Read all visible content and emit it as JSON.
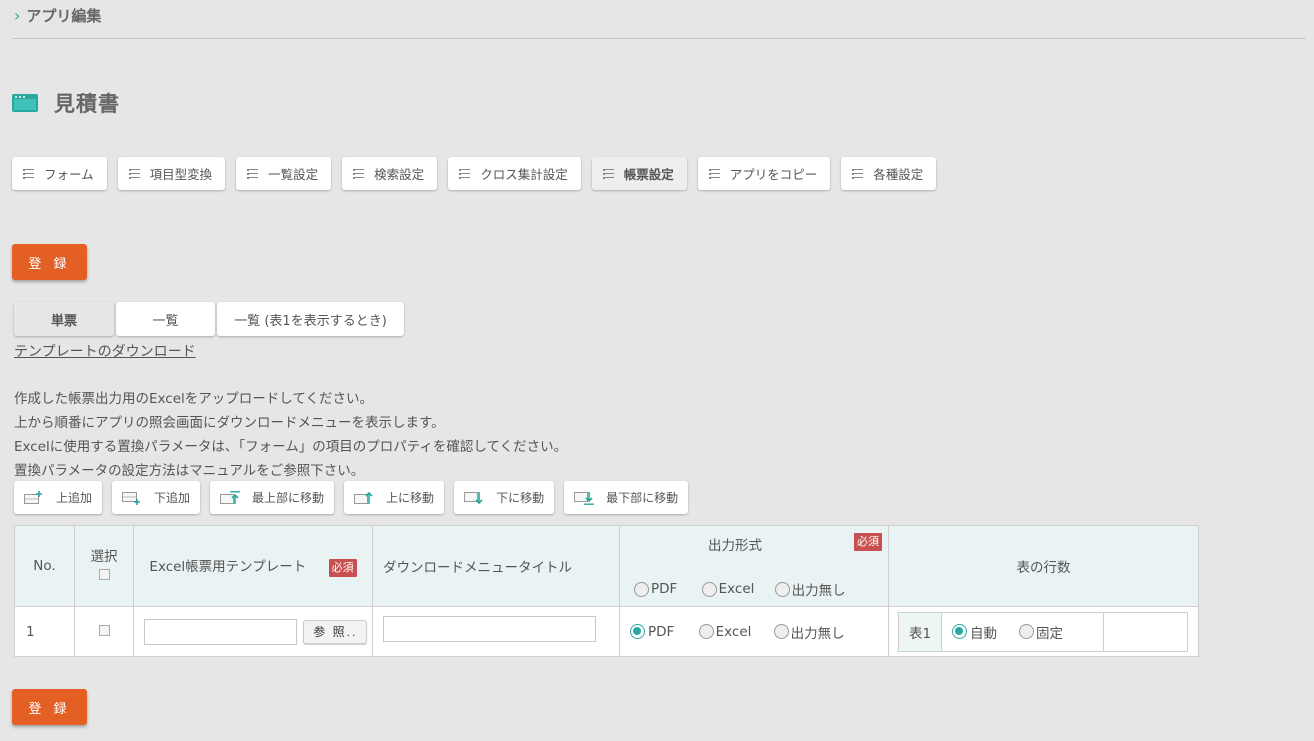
{
  "breadcrumb": {
    "label": "アプリ編集"
  },
  "page": {
    "title": "見積書"
  },
  "nav_tabs": [
    {
      "label": "フォーム",
      "active": false
    },
    {
      "label": "項目型変換",
      "active": false
    },
    {
      "label": "一覧設定",
      "active": false
    },
    {
      "label": "検索設定",
      "active": false
    },
    {
      "label": "クロス集計設定",
      "active": false
    },
    {
      "label": "帳票設定",
      "active": true
    },
    {
      "label": "アプリをコピー",
      "active": false
    },
    {
      "label": "各種設定",
      "active": false
    }
  ],
  "register_label": "登 録",
  "sub_tabs": [
    {
      "label": "単票",
      "active": true
    },
    {
      "label": "一覧",
      "active": false
    },
    {
      "label": "一覧 (表1を表示するとき)",
      "active": false
    }
  ],
  "download_link": "テンプレートのダウンロード",
  "description": [
    "作成した帳票出力用のExcelをアップロードしてください。",
    "上から順番にアプリの照会画面にダウンロードメニューを表示します。",
    "Excelに使用する置換パラメータは、「フォーム」の項目のプロパティを確認してください。",
    "置換パラメータの設定方法はマニュアルをご参照下さい。"
  ],
  "toolbar": {
    "add_above": "上追加",
    "add_below": "下追加",
    "move_top": "最上部に移動",
    "move_up": "上に移動",
    "move_down": "下に移動",
    "move_bottom": "最下部に移動"
  },
  "table": {
    "headers": {
      "no": "No.",
      "select": "選択",
      "template": "Excel帳票用テンプレート",
      "menu_title": "ダウンロードメニュータイトル",
      "output_format": "出力形式",
      "row_count": "表の行数"
    },
    "required_badge": "必須",
    "format_options": [
      "PDF",
      "Excel",
      "出力無し"
    ],
    "rows": [
      {
        "no": "1",
        "browse_label": "参 照..",
        "selected_format": "PDF",
        "table_label": "表1",
        "row_mode_options": [
          "自動",
          "固定"
        ],
        "selected_row_mode": "自動"
      }
    ]
  },
  "colors": {
    "accent": "#2aa8a0",
    "primary_button": "#e35f23",
    "required_badge": "#c85050"
  }
}
